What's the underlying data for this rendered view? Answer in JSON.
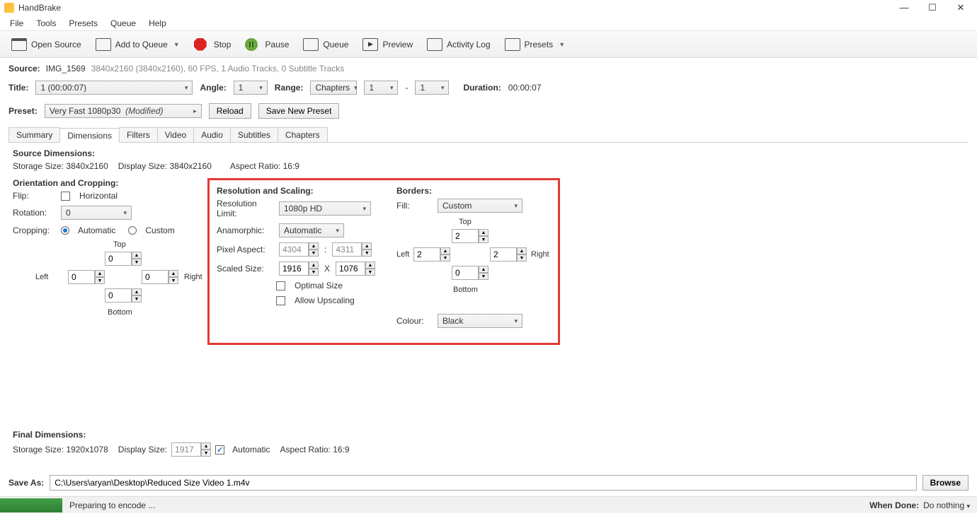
{
  "app": {
    "title": "HandBrake"
  },
  "menus": [
    "File",
    "Tools",
    "Presets",
    "Queue",
    "Help"
  ],
  "toolbar": {
    "open_source": "Open Source",
    "add_queue": "Add to Queue",
    "stop": "Stop",
    "pause": "Pause",
    "queue": "Queue",
    "preview": "Preview",
    "activity_log": "Activity Log",
    "presets": "Presets"
  },
  "source": {
    "label": "Source:",
    "name": "IMG_1569",
    "details": "3840x2160 (3840x2160), 60 FPS, 1 Audio Tracks, 0 Subtitle Tracks"
  },
  "title_row": {
    "title_label": "Title:",
    "title_value": "1  (00:00:07)",
    "angle_label": "Angle:",
    "angle_value": "1",
    "range_label": "Range:",
    "range_type": "Chapters",
    "range_from": "1",
    "range_sep": "-",
    "range_to": "1",
    "duration_label": "Duration:",
    "duration_value": "00:00:07"
  },
  "preset_row": {
    "preset_label": "Preset:",
    "preset_value": "Very Fast 1080p30",
    "preset_modified": "(Modified)",
    "reload": "Reload",
    "save_new": "Save New Preset"
  },
  "tabs": [
    "Summary",
    "Dimensions",
    "Filters",
    "Video",
    "Audio",
    "Subtitles",
    "Chapters"
  ],
  "source_dim": {
    "head": "Source Dimensions:",
    "storage_label": "Storage Size:",
    "storage_value": "3840x2160",
    "display_label": "Display Size:",
    "display_value": "3840x2160",
    "aspect_label": "Aspect Ratio:",
    "aspect_value": "16:9"
  },
  "orient": {
    "head": "Orientation and Cropping:",
    "flip_label": "Flip:",
    "flip_horizontal": "Horizontal",
    "rotation_label": "Rotation:",
    "rotation_value": "0",
    "cropping_label": "Cropping:",
    "auto": "Automatic",
    "custom": "Custom",
    "top": "Top",
    "left": "Left",
    "right": "Right",
    "bottom": "Bottom",
    "crop_top": "0",
    "crop_left": "0",
    "crop_right": "0",
    "crop_bottom": "0"
  },
  "res": {
    "head": "Resolution and Scaling:",
    "limit_label": "Resolution Limit:",
    "limit_value": "1080p HD",
    "ana_label": "Anamorphic:",
    "ana_value": "Automatic",
    "pixel_label": "Pixel Aspect:",
    "pixel_w": "4304",
    "pixel_sep": ":",
    "pixel_h": "4311",
    "scaled_label": "Scaled Size:",
    "scaled_w": "1916",
    "scaled_sep": "X",
    "scaled_h": "1076",
    "optimal": "Optimal Size",
    "upscale": "Allow Upscaling"
  },
  "borders": {
    "head": "Borders:",
    "fill_label": "Fill:",
    "fill_value": "Custom",
    "top": "Top",
    "left": "Left",
    "right": "Right",
    "bottom": "Bottom",
    "b_top": "2",
    "b_left": "2",
    "b_right": "2",
    "b_bottom": "0",
    "colour_label": "Colour:",
    "colour_value": "Black"
  },
  "final": {
    "head": "Final Dimensions:",
    "storage_label": "Storage Size:",
    "storage_value": "1920x1078",
    "display_label": "Display Size:",
    "display_value": "1917",
    "auto": "Automatic",
    "aspect_label": "Aspect Ratio:",
    "aspect_value": "16:9"
  },
  "save": {
    "label": "Save As:",
    "path": "C:\\Users\\aryan\\Desktop\\Reduced Size Video 1.m4v",
    "browse": "Browse"
  },
  "status": {
    "msg": "Preparing to encode ...",
    "when_done_label": "When Done:",
    "when_done_value": "Do nothing"
  }
}
